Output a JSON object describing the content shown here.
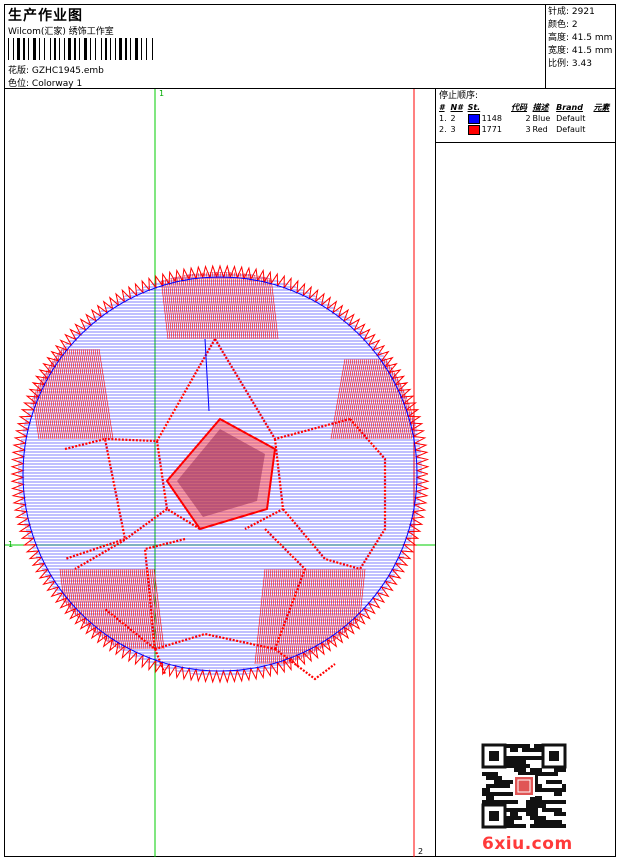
{
  "header": {
    "title": "生产作业图",
    "subtitle": "Wilcom(汇家) 绣饰工作室",
    "design_label": "花版:",
    "design_value": "GZHC1945.emb",
    "colorway_label": "色位:",
    "colorway_value": "Colorway 1"
  },
  "stats": [
    {
      "label": "针成:",
      "value": "2921"
    },
    {
      "label": "颜色:",
      "value": "2"
    },
    {
      "label": "高度:",
      "value": "41.5 mm"
    },
    {
      "label": "宽度:",
      "value": "41.5 mm"
    },
    {
      "label": "比例:",
      "value": "3.43"
    }
  ],
  "stop_sequence": {
    "title": "停止顺序:",
    "columns": [
      "#",
      "N#",
      "St.",
      "代码",
      "描述",
      "Brand",
      "元素"
    ],
    "rows": [
      {
        "index": "1.",
        "needle": "2",
        "color": "#0000ff",
        "stitches": "1148",
        "code": "2",
        "description": "Blue",
        "brand": "Default"
      },
      {
        "index": "2.",
        "needle": "3",
        "color": "#ff0000",
        "stitches": "1771",
        "code": "3",
        "description": "Red",
        "brand": "Default"
      }
    ]
  },
  "canvas": {
    "guide_green_top": "1",
    "guide_green_left": "1",
    "guide_red_bottom": "2",
    "guide_green_color": "#00cc00",
    "guide_red_color": "#ff0000",
    "thread_blue": "#0000ff",
    "thread_red": "#ff0000"
  },
  "watermark": {
    "text": "6xiu.com",
    "qr_stamp_icon": "qr-code-with-seal"
  }
}
